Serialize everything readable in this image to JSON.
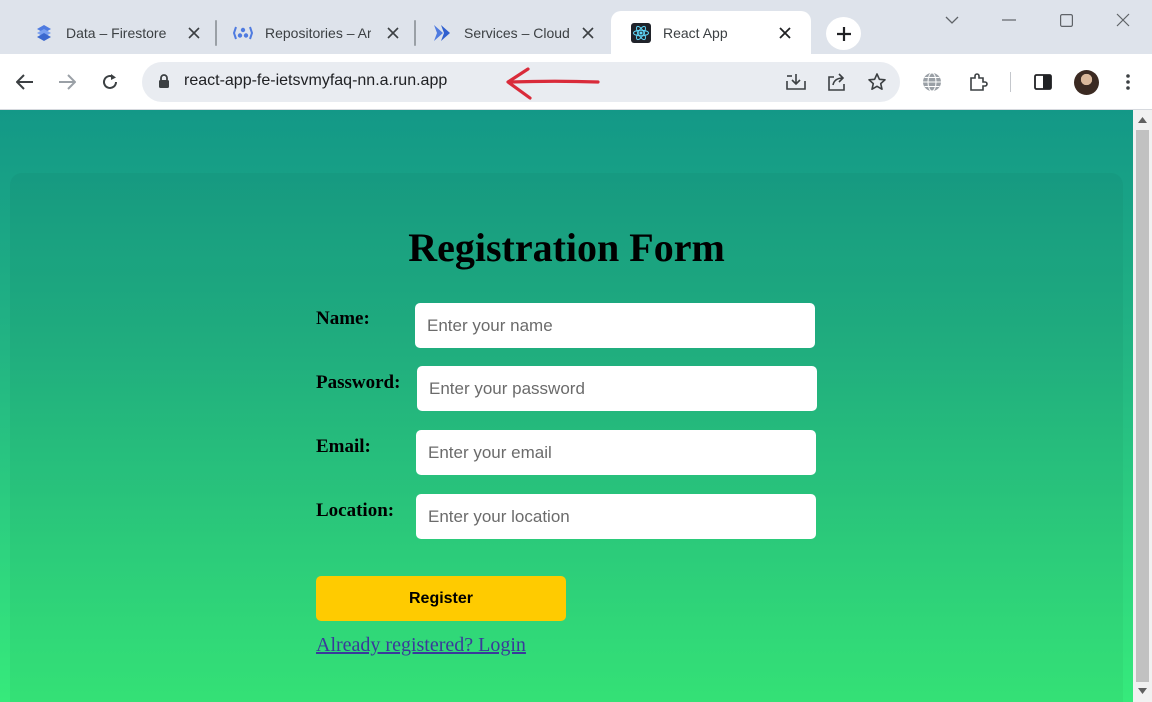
{
  "browser": {
    "tabs": [
      {
        "title": "Data – Firestore",
        "icon": "firestore-icon",
        "active": false
      },
      {
        "title": "Repositories – Ar",
        "icon": "artifact-registry-icon",
        "active": false
      },
      {
        "title": "Services – Cloud",
        "icon": "cloud-run-icon",
        "active": false
      },
      {
        "title": "React App",
        "icon": "react-icon",
        "active": true
      }
    ],
    "address_bar": {
      "url": "react-app-fe-ietsvmyfaq-nn.a.run.app"
    }
  },
  "colors": {
    "accent_button": "#ffcb00",
    "gradient_top": "#139887",
    "gradient_bottom": "#36ea7b",
    "annotation_arrow": "#d92b3a"
  },
  "form": {
    "title": "Registration Form",
    "fields": [
      {
        "label": "Name:",
        "placeholder": "Enter your name",
        "value": ""
      },
      {
        "label": "Password:",
        "placeholder": "Enter your password",
        "value": ""
      },
      {
        "label": "Email:",
        "placeholder": "Enter your email",
        "value": ""
      },
      {
        "label": "Location:",
        "placeholder": "Enter your location",
        "value": ""
      }
    ],
    "submit_label": "Register",
    "login_link": "Already registered? Login"
  }
}
